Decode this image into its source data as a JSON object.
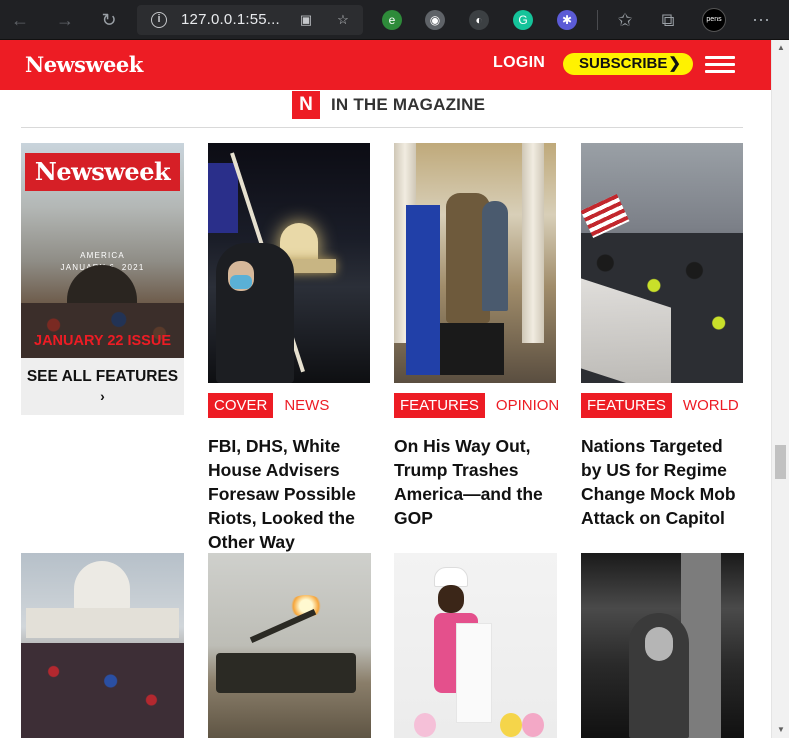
{
  "browser": {
    "url": "127.0.0.1:55...",
    "avatar_label": "pens"
  },
  "header": {
    "logo": "Newsweek",
    "login": "LOGIN",
    "subscribe": "SUBSCRIBE",
    "accent_color": "#ed1c24",
    "subscribe_color": "#fff200"
  },
  "section": {
    "badge": "N",
    "title": "IN THE MAGAZINE"
  },
  "magazine": {
    "mast": "Newsweek",
    "caption_line1": "AMERICA",
    "caption_line2": "JANUARY 6, 2021",
    "issue": "JANUARY 22 ISSUE",
    "see_all": "SEE ALL FEATURES",
    "see_all_chevron": "›"
  },
  "stories": [
    {
      "primary_tag": "COVER",
      "secondary_tag": "NEWS",
      "headline": "FBI, DHS, White House Advisers Foresaw Possible Riots, Looked the Other Way"
    },
    {
      "primary_tag": "FEATURES",
      "secondary_tag": "OPINION",
      "headline": "On His Way Out, Trump Trashes America—and the GOP"
    },
    {
      "primary_tag": "FEATURES",
      "secondary_tag": "WORLD",
      "headline": "Nations Targeted by US for Regime Change Mock Mob Attack on Capitol"
    }
  ]
}
